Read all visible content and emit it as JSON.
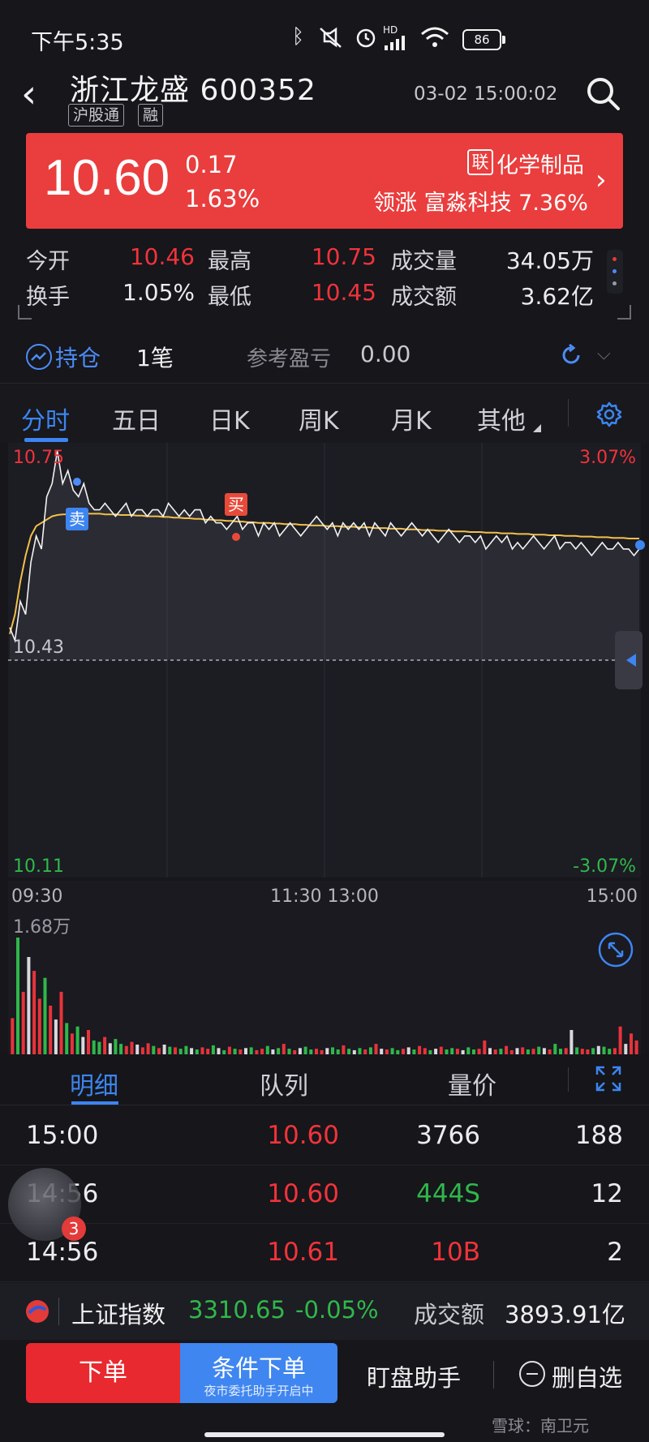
{
  "status_bar": {
    "time": "下午5:35",
    "network": "HD",
    "battery": "86",
    "icons": [
      "bluetooth-icon",
      "mute-icon",
      "alarm-icon",
      "signal-icon",
      "wifi-icon",
      "battery-icon"
    ]
  },
  "header": {
    "back_icon": "‹",
    "title": "浙江龙盛 600352",
    "tags": [
      "沪股通",
      "融"
    ],
    "datetime": "03-02 15:00:02"
  },
  "quote": {
    "price": "10.60",
    "change": "0.17",
    "change_pct": "1.63%",
    "sector_badge": "联",
    "sector": "化学制品",
    "leader": "领涨 富淼科技 7.36%",
    "chevron": "›",
    "banner_color": "#ea3d3d"
  },
  "stats": {
    "open_label": "今开",
    "open": "10.46",
    "high_label": "最高",
    "high": "10.75",
    "volume_label": "成交量",
    "volume": "34.05万",
    "turnover_label": "换手",
    "turnover": "1.05%",
    "low_label": "最低",
    "low": "10.45",
    "amount_label": "成交额",
    "amount": "3.62亿"
  },
  "position": {
    "label": "持仓",
    "count": "1笔",
    "pnl_label": "参考盈亏",
    "pnl": "0.00",
    "dropdown": "⌵"
  },
  "tabs": [
    {
      "label": "分时",
      "active": true
    },
    {
      "label": "五日"
    },
    {
      "label": "日K"
    },
    {
      "label": "周K"
    },
    {
      "label": "月K"
    },
    {
      "label": "其他"
    }
  ],
  "chart_labels": {
    "top_price": "10.75",
    "top_pct": "3.07%",
    "mid_price": "10.43",
    "bottom_price": "10.11",
    "bottom_pct": "-3.07%",
    "time_ticks": [
      "09:30",
      "11:30 13:00",
      "15:00"
    ],
    "volume_max": "1.68万",
    "sell_mark": "卖",
    "buy_mark": "买"
  },
  "chart_data": {
    "type": "line",
    "title": "",
    "ylim": [
      10.11,
      10.75
    ],
    "prev_close": 10.43,
    "series": [],
    "price": [
      10.48,
      10.46,
      10.52,
      10.5,
      10.58,
      10.62,
      10.6,
      10.68,
      10.7,
      10.75,
      10.7,
      10.72,
      10.69,
      10.68,
      10.7,
      10.67,
      10.66,
      10.66,
      10.67,
      10.66,
      10.65,
      10.66,
      10.67,
      10.65,
      10.66,
      10.66,
      10.65,
      10.66,
      10.66,
      10.65,
      10.67,
      10.66,
      10.65,
      10.66,
      10.65,
      10.66,
      10.66,
      10.64,
      10.65,
      10.64,
      10.64,
      10.63,
      10.64,
      10.65,
      10.63,
      10.64,
      10.64,
      10.62,
      10.64,
      10.63,
      10.64,
      10.62,
      10.63,
      10.64,
      10.63,
      10.62,
      10.63,
      10.64,
      10.65,
      10.64,
      10.63,
      10.64,
      10.62,
      10.64,
      10.63,
      10.64,
      10.63,
      10.64,
      10.62,
      10.64,
      10.63,
      10.62,
      10.64,
      10.63,
      10.62,
      10.63,
      10.64,
      10.63,
      10.62,
      10.63,
      10.62,
      10.61,
      10.62,
      10.63,
      10.62,
      10.61,
      10.62,
      10.62,
      10.61,
      10.62,
      10.6,
      10.61,
      10.62,
      10.61,
      10.62,
      10.6,
      10.61,
      10.6,
      10.61,
      10.62,
      10.61,
      10.6,
      10.61,
      10.62,
      10.6,
      10.61,
      10.61,
      10.6,
      10.61,
      10.6,
      10.59,
      10.6,
      10.61,
      10.6,
      10.6,
      10.61,
      10.6,
      10.6,
      10.59,
      10.6
    ],
    "avg": [
      10.47,
      10.5,
      10.55,
      10.59,
      10.62,
      10.635,
      10.64,
      10.645,
      10.65,
      10.652,
      10.653,
      10.653,
      10.653,
      10.654,
      10.654,
      10.654,
      10.654,
      10.654,
      10.653,
      10.653,
      10.653,
      10.652,
      10.652,
      10.652,
      10.651,
      10.651,
      10.65,
      10.65,
      10.65,
      10.649,
      10.649,
      10.648,
      10.648,
      10.647,
      10.647,
      10.646,
      10.646,
      10.645,
      10.645,
      10.644,
      10.644,
      10.643,
      10.643,
      10.642,
      10.642,
      10.641,
      10.641,
      10.64,
      10.64,
      10.64,
      10.639,
      10.639,
      10.638,
      10.638,
      10.638,
      10.637,
      10.637,
      10.636,
      10.636,
      10.636,
      10.635,
      10.635,
      10.635,
      10.634,
      10.634,
      10.634,
      10.633,
      10.633,
      10.633,
      10.632,
      10.632,
      10.632,
      10.631,
      10.631,
      10.631,
      10.63,
      10.63,
      10.63,
      10.629,
      10.629,
      10.629,
      10.628,
      10.628,
      10.628,
      10.627,
      10.627,
      10.627,
      10.626,
      10.626,
      10.626,
      10.625,
      10.625,
      10.625,
      10.624,
      10.624,
      10.624,
      10.623,
      10.623,
      10.623,
      10.622,
      10.622,
      10.622,
      10.621,
      10.621,
      10.621,
      10.62,
      10.62,
      10.62,
      10.619,
      10.619,
      10.619,
      10.618,
      10.618,
      10.618,
      10.617,
      10.617,
      10.617,
      10.616,
      10.616,
      10.616
    ],
    "volume_max": 16800,
    "volume": [
      5200,
      16800,
      9000,
      14000,
      12000,
      8000,
      11000,
      7000,
      5000,
      9000,
      4500,
      3000,
      4000,
      2500,
      3500,
      2000,
      1800,
      2500,
      1600,
      2200,
      1500,
      1200,
      1800,
      1400,
      1000,
      1600,
      1200,
      900,
      1400,
      1100,
      1000,
      800,
      1200,
      900,
      700,
      1000,
      800,
      1300,
      900,
      600,
      1100,
      800,
      700,
      900,
      1000,
      600,
      800,
      1200,
      700,
      900,
      1500,
      800,
      600,
      900,
      1100,
      700,
      800,
      600,
      900,
      1000,
      700,
      1300,
      800,
      600,
      900,
      700,
      1000,
      1500,
      800,
      700,
      900,
      600,
      800,
      1000,
      700,
      1200,
      900,
      600,
      800,
      1100,
      700,
      900,
      800,
      600,
      1000,
      700,
      800,
      2000,
      900,
      700,
      800,
      1200,
      600,
      900,
      1000,
      700,
      800,
      1100,
      900,
      700,
      1500,
      800,
      900,
      3500,
      1000,
      800,
      700,
      900,
      1200,
      1100,
      800,
      900,
      4000,
      1500,
      3000,
      2000
    ]
  },
  "detail_tabs": [
    {
      "label": "明细",
      "active": true
    },
    {
      "label": "队列"
    },
    {
      "label": "量价"
    }
  ],
  "trades": [
    {
      "time": "15:00",
      "price": "10.60",
      "volume": "3766",
      "count": "188",
      "vol_color": "white"
    },
    {
      "time": "14:56",
      "price": "10.60",
      "volume": "444S",
      "count": "12",
      "vol_color": "green"
    },
    {
      "time": "14:56",
      "price": "10.61",
      "volume": "10B",
      "count": "2",
      "vol_color": "red"
    }
  ],
  "floating_badge": "3",
  "index_bar": {
    "name": "上证指数",
    "value": "3310.65",
    "change_pct": "-0.05%",
    "amount_label": "成交额",
    "amount": "3893.91亿"
  },
  "actions": {
    "order": "下单",
    "conditional": "条件下单",
    "conditional_sub": "夜市委托助手开启中",
    "monitor": "盯盘助手",
    "remove": "删自选"
  },
  "watermark": "雪球：南卫元"
}
